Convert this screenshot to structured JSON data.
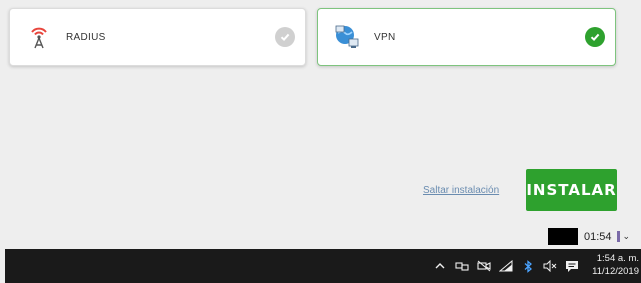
{
  "cards": [
    {
      "label": "RADIUS",
      "selected": false,
      "icon": "radio-tower-icon"
    },
    {
      "label": "VPN",
      "selected": true,
      "icon": "vpn-network-icon"
    }
  ],
  "actions": {
    "skip_label": "Saltar instalación",
    "install_label": "INSTALAR"
  },
  "timer": {
    "value": "01:54"
  },
  "taskbar": {
    "tray_icons": [
      "chevron-up-icon",
      "network-icon",
      "camera-off-icon",
      "wifi-icon",
      "bluetooth-icon",
      "volume-muted-icon",
      "notifications-icon"
    ],
    "time": "1:54 a. m.",
    "date": "11/12/2019"
  },
  "colors": {
    "accent_green": "#2ea12e",
    "selected_border": "#7ec47e",
    "link": "#6a8cb0",
    "radius_icon": "#e8453c",
    "taskbar": "#1a1a1a"
  }
}
